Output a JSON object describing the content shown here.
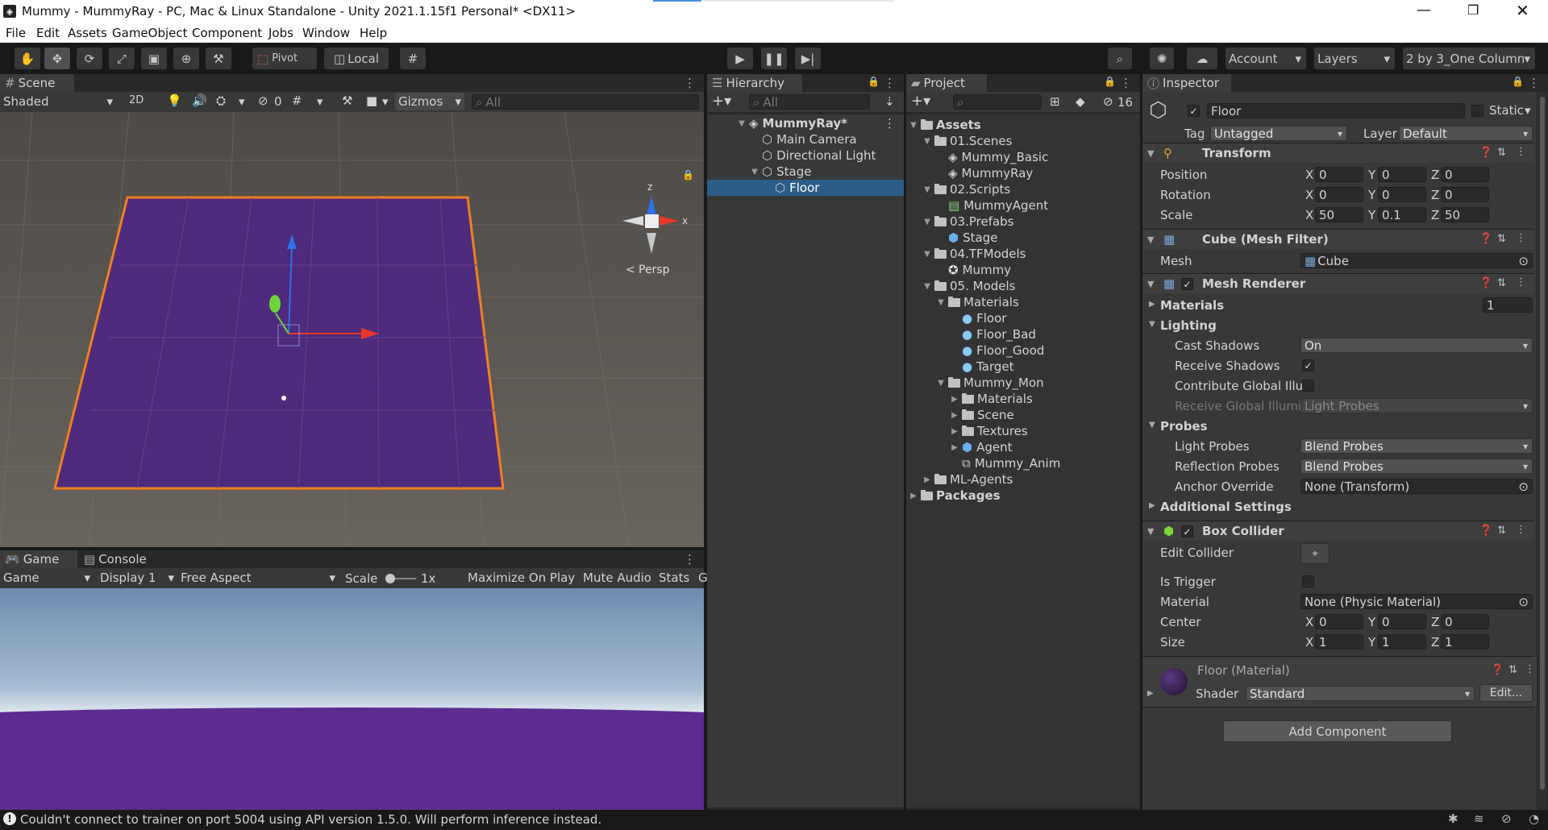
{
  "titlebar": {
    "title": "Mummy - MummyRay - PC, Mac & Linux Standalone - Unity 2021.1.15f1 Personal* <DX11>"
  },
  "menu": [
    "File",
    "Edit",
    "Assets",
    "GameObject",
    "Component",
    "Jobs",
    "Window",
    "Help"
  ],
  "toolbar": {
    "pivot_label": "Pivot",
    "local_label": "Local",
    "account_label": "Account",
    "layers_label": "Layers",
    "layout_label": "2 by 3_One Column"
  },
  "scene": {
    "tab_label": "Scene",
    "shading_mode": "Shaded",
    "mode_2d": "2D",
    "hidden_count": "0",
    "gizmos_label": "Gizmos",
    "search_placeholder": "All",
    "persp_label": "Persp",
    "axis_z": "z",
    "axis_x": "x",
    "floor_color": "#4e2b7c",
    "selection_color": "#f08020"
  },
  "game": {
    "tab_label": "Game",
    "console_tab": "Console",
    "view_select": "Game",
    "display_select": "Display 1",
    "aspect_select": "Free Aspect",
    "scale_label": "Scale",
    "scale_value": "1x",
    "maximize_label": "Maximize On Play",
    "mute_label": "Mute Audio",
    "stats_label": "Stats"
  },
  "hierarchy": {
    "tab_label": "Hierarchy",
    "search_placeholder": "All",
    "items": [
      {
        "label": "MummyRay*",
        "depth": 0,
        "expanded": true,
        "bold": true
      },
      {
        "label": "Main Camera",
        "depth": 1
      },
      {
        "label": "Directional Light",
        "depth": 1
      },
      {
        "label": "Stage",
        "depth": 1,
        "expanded": true
      },
      {
        "label": "Floor",
        "depth": 2,
        "selected": true
      }
    ]
  },
  "project": {
    "tab_label": "Project",
    "hidden_count": "16",
    "items": [
      {
        "label": "Assets",
        "depth": 0,
        "kind": "folder",
        "expanded": true,
        "bold": true
      },
      {
        "label": "01.Scenes",
        "depth": 1,
        "kind": "folder",
        "expanded": true
      },
      {
        "label": "Mummy_Basic",
        "depth": 2,
        "kind": "scene"
      },
      {
        "label": "MummyRay",
        "depth": 2,
        "kind": "scene"
      },
      {
        "label": "02.Scripts",
        "depth": 1,
        "kind": "folder",
        "expanded": true
      },
      {
        "label": "MummyAgent",
        "depth": 2,
        "kind": "script"
      },
      {
        "label": "03.Prefabs",
        "depth": 1,
        "kind": "folder",
        "expanded": true
      },
      {
        "label": "Stage",
        "depth": 2,
        "kind": "prefab"
      },
      {
        "label": "04.TFModels",
        "depth": 1,
        "kind": "folder",
        "expanded": true
      },
      {
        "label": "Mummy",
        "depth": 2,
        "kind": "model"
      },
      {
        "label": "05. Models",
        "depth": 1,
        "kind": "folder",
        "expanded": true
      },
      {
        "label": "Materials",
        "depth": 2,
        "kind": "folder",
        "expanded": true
      },
      {
        "label": "Floor",
        "depth": 3,
        "kind": "material"
      },
      {
        "label": "Floor_Bad",
        "depth": 3,
        "kind": "material"
      },
      {
        "label": "Floor_Good",
        "depth": 3,
        "kind": "material"
      },
      {
        "label": "Target",
        "depth": 3,
        "kind": "material"
      },
      {
        "label": "Mummy_Mon",
        "depth": 2,
        "kind": "folder",
        "expanded": true
      },
      {
        "label": "Materials",
        "depth": 3,
        "kind": "folder",
        "expanded": false
      },
      {
        "label": "Scene",
        "depth": 3,
        "kind": "folder",
        "expanded": false
      },
      {
        "label": "Textures",
        "depth": 3,
        "kind": "folder",
        "expanded": false
      },
      {
        "label": "Agent",
        "depth": 3,
        "kind": "prefab",
        "expanded": false
      },
      {
        "label": "Mummy_Anim",
        "depth": 3,
        "kind": "anim"
      },
      {
        "label": "ML-Agents",
        "depth": 1,
        "kind": "folder",
        "expanded": false
      },
      {
        "label": "Packages",
        "depth": 0,
        "kind": "folder",
        "expanded": false,
        "bold": true
      }
    ]
  },
  "inspector": {
    "tab_label": "Inspector",
    "object_name": "Floor",
    "static_label": "Static",
    "tag_label": "Tag",
    "tag_value": "Untagged",
    "layer_label": "Layer",
    "layer_value": "Default",
    "transform": {
      "title": "Transform",
      "position_label": "Position",
      "rotation_label": "Rotation",
      "scale_label": "Scale",
      "position": {
        "x": "0",
        "y": "0",
        "z": "0"
      },
      "rotation": {
        "x": "0",
        "y": "0",
        "z": "0"
      },
      "scale": {
        "x": "50",
        "y": "0.1",
        "z": "50"
      }
    },
    "mesh_filter": {
      "title": "Cube (Mesh Filter)",
      "mesh_label": "Mesh",
      "mesh_value": "Cube"
    },
    "mesh_renderer": {
      "title": "Mesh Renderer",
      "materials_label": "Materials",
      "materials_count": "1",
      "lighting_label": "Lighting",
      "cast_shadows_label": "Cast Shadows",
      "cast_shadows_value": "On",
      "receive_shadows_label": "Receive Shadows",
      "contribute_gi_label": "Contribute Global Illun",
      "receive_gi_label": "Receive Global Illumir",
      "receive_gi_value": "Light Probes",
      "probes_label": "Probes",
      "light_probes_label": "Light Probes",
      "light_probes_value": "Blend Probes",
      "reflection_probes_label": "Reflection Probes",
      "reflection_probes_value": "Blend Probes",
      "anchor_override_label": "Anchor Override",
      "anchor_override_value": "None (Transform)",
      "additional_settings_label": "Additional Settings"
    },
    "box_collider": {
      "title": "Box Collider",
      "edit_collider_label": "Edit Collider",
      "is_trigger_label": "Is Trigger",
      "material_label": "Material",
      "material_value": "None (Physic Material)",
      "center_label": "Center",
      "size_label": "Size",
      "center": {
        "x": "0",
        "y": "0",
        "z": "0"
      },
      "size": {
        "x": "1",
        "y": "1",
        "z": "1"
      }
    },
    "material": {
      "title": "Floor (Material)",
      "shader_label": "Shader",
      "shader_value": "Standard",
      "edit_label": "Edit..."
    },
    "add_component_label": "Add Component"
  },
  "statusbar": {
    "message": "Couldn't connect to trainer on port 5004 using API version 1.5.0. Will perform inference instead."
  }
}
